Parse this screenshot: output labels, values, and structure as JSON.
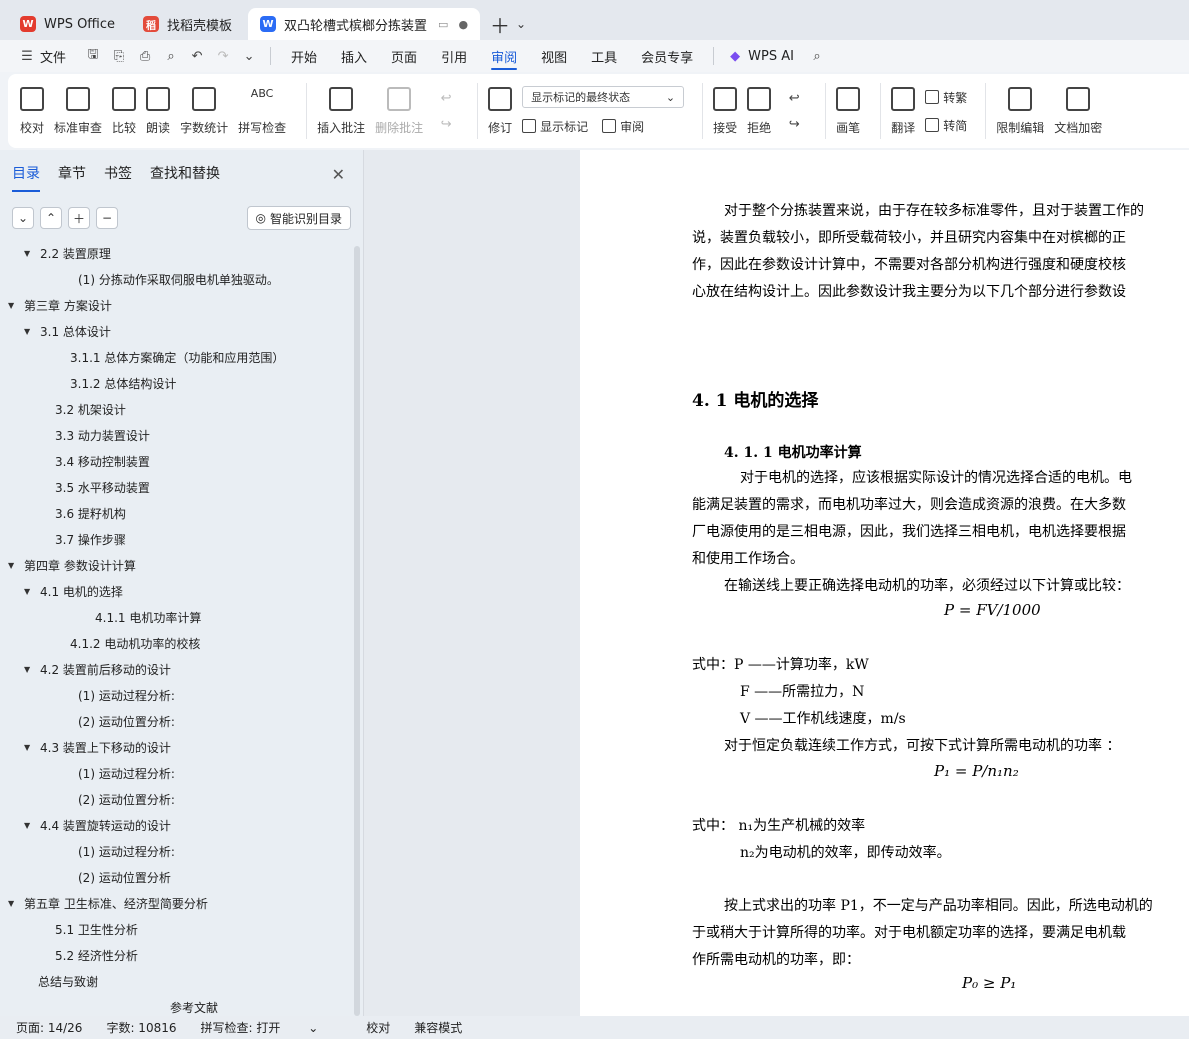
{
  "tabs": [
    {
      "label": "WPS Office",
      "color": "#e33b2e",
      "logo": "W"
    },
    {
      "label": "找稻壳模板",
      "color": "#e34b3b",
      "logo": "稻"
    },
    {
      "label": "双凸轮槽式槟榔分拣装置（分",
      "color": "#2b6cf5",
      "logo": "W"
    }
  ],
  "menu": {
    "file": "文件",
    "items": [
      "开始",
      "插入",
      "页面",
      "引用",
      "审阅",
      "视图",
      "工具",
      "会员专享"
    ],
    "active": "审阅",
    "ai": "WPS AI"
  },
  "ribbon": {
    "proof": [
      "校对",
      "标准审查",
      "比较",
      "朗读",
      "字数统计",
      "拼写检查"
    ],
    "insert_comment": "插入批注",
    "delete_comment": "删除批注",
    "revise": "修订",
    "show_select": "显示标记的最终状态",
    "show_marks": "显示标记",
    "review": "审阅",
    "accept": "接受",
    "reject": "拒绝",
    "pen": "画笔",
    "translate": "翻译",
    "to_trad": "转繁",
    "to_simp": "转简",
    "restrict": "限制编辑",
    "encrypt": "文档加密"
  },
  "panel": {
    "tabs": [
      "目录",
      "章节",
      "书签",
      "查找和替换"
    ],
    "smart": "智能识别目录",
    "toc": [
      {
        "t": "2.2  装置原理",
        "i": 40,
        "tri": "▼"
      },
      {
        "t": "(1) 分拣动作采取伺服电机单独驱动。",
        "i": 78,
        "tri": ""
      },
      {
        "t": "第三章   方案设计",
        "i": 24,
        "tri": "▼"
      },
      {
        "t": "3.1    总体设计",
        "i": 40,
        "tri": "▼"
      },
      {
        "t": "3.1.1  总体方案确定（功能和应用范围）",
        "i": 70,
        "tri": ""
      },
      {
        "t": "3.1.2  总体结构设计",
        "i": 70,
        "tri": ""
      },
      {
        "t": "3.2    机架设计",
        "i": 55,
        "tri": ""
      },
      {
        "t": "3.3    动力装置设计",
        "i": 55,
        "tri": ""
      },
      {
        "t": "3.4    移动控制装置",
        "i": 55,
        "tri": ""
      },
      {
        "t": "3.5    水平移动装置",
        "i": 55,
        "tri": ""
      },
      {
        "t": "3.6    提籽机构",
        "i": 55,
        "tri": ""
      },
      {
        "t": "3.7    操作步骤",
        "i": 55,
        "tri": ""
      },
      {
        "t": "第四章  参数设计计算",
        "i": 24,
        "tri": "▼"
      },
      {
        "t": "4.1  电机的选择",
        "i": 40,
        "tri": "▼"
      },
      {
        "t": "4.1.1  电机功率计算",
        "i": 95,
        "tri": ""
      },
      {
        "t": "4.1.2  电动机功率的校核",
        "i": 70,
        "tri": ""
      },
      {
        "t": "4.2    装置前后移动的设计",
        "i": 40,
        "tri": "▼"
      },
      {
        "t": "(1) 运动过程分析:",
        "i": 78,
        "tri": ""
      },
      {
        "t": "(2) 运动位置分析:",
        "i": 78,
        "tri": ""
      },
      {
        "t": "4.3    装置上下移动的设计",
        "i": 40,
        "tri": "▼"
      },
      {
        "t": "(1) 运动过程分析:",
        "i": 78,
        "tri": ""
      },
      {
        "t": "(2) 运动位置分析:",
        "i": 78,
        "tri": ""
      },
      {
        "t": "4.4  装置旋转运动的设计",
        "i": 40,
        "tri": "▼"
      },
      {
        "t": "(1) 运动过程分析:",
        "i": 78,
        "tri": ""
      },
      {
        "t": "(2) 运动位置分析",
        "i": 78,
        "tri": ""
      },
      {
        "t": "第五章   卫生标准、经济型简要分析",
        "i": 24,
        "tri": "▼"
      },
      {
        "t": "5.1  卫生性分析",
        "i": 55,
        "tri": ""
      },
      {
        "t": "5.2  经济性分析",
        "i": 55,
        "tri": ""
      },
      {
        "t": "总结与致谢",
        "i": 38,
        "tri": ""
      },
      {
        "t": "参考文献",
        "i": 170,
        "tri": ""
      }
    ]
  },
  "doc": {
    "p1": [
      "对于整个分拣装置来说，由于存在较多标准零件，且对于装置工作的",
      "说，装置负载较小，即所受载荷较小，并且研究内容集中在对槟榔的正",
      "作，因此在参数设计计算中，不需要对各部分机构进行强度和硬度校核",
      "心放在结构设计上。因此参数设计我主要分为以下几个部分进行参数设"
    ],
    "h41": "4. 1  电机的选择",
    "h411": "4. 1. 1  电机功率计算",
    "p2": [
      "对于电机的选择，应该根据实际设计的情况选择合适的电机。电",
      "能满足装置的需求，而电机功率过大，则会造成资源的浪费。在大多数",
      "厂电源使用的是三相电源，因此，我们选择三相电机，电机选择要根据",
      "和使用工作场合。"
    ],
    "p3": "在输送线上要正确选择电动机的功率，必须经过以下计算或比较：",
    "f1": "P = FV/1000",
    "w1": "式中：P ——计算功率，kW",
    "w2": "F ——所需拉力，N",
    "w3": "V ——工作机线速度，m/s",
    "p4": "对于恒定负载连续工作方式，可按下式计算所需电动机的功率   ：",
    "f2": "P₁ = P/n₁n₂",
    "w4": "式中：    n₁为生产机械的效率",
    "w5": "n₂为电动机的效率，即传动效率。",
    "p5": [
      "按上式求出的功率 P1，不一定与产品功率相同。因此，所选电动机的",
      "于或稍大于计算所得的功率。对于电机额定功率的选择，要满足电机载",
      "作所需电动机的功率，即："
    ],
    "f3": "P₀ ≥ P₁"
  },
  "status": {
    "page": "页面: 14/26",
    "words": "字数: 10816",
    "spell": "拼写检查: 打开",
    "proof": "校对",
    "compat": "兼容模式"
  }
}
